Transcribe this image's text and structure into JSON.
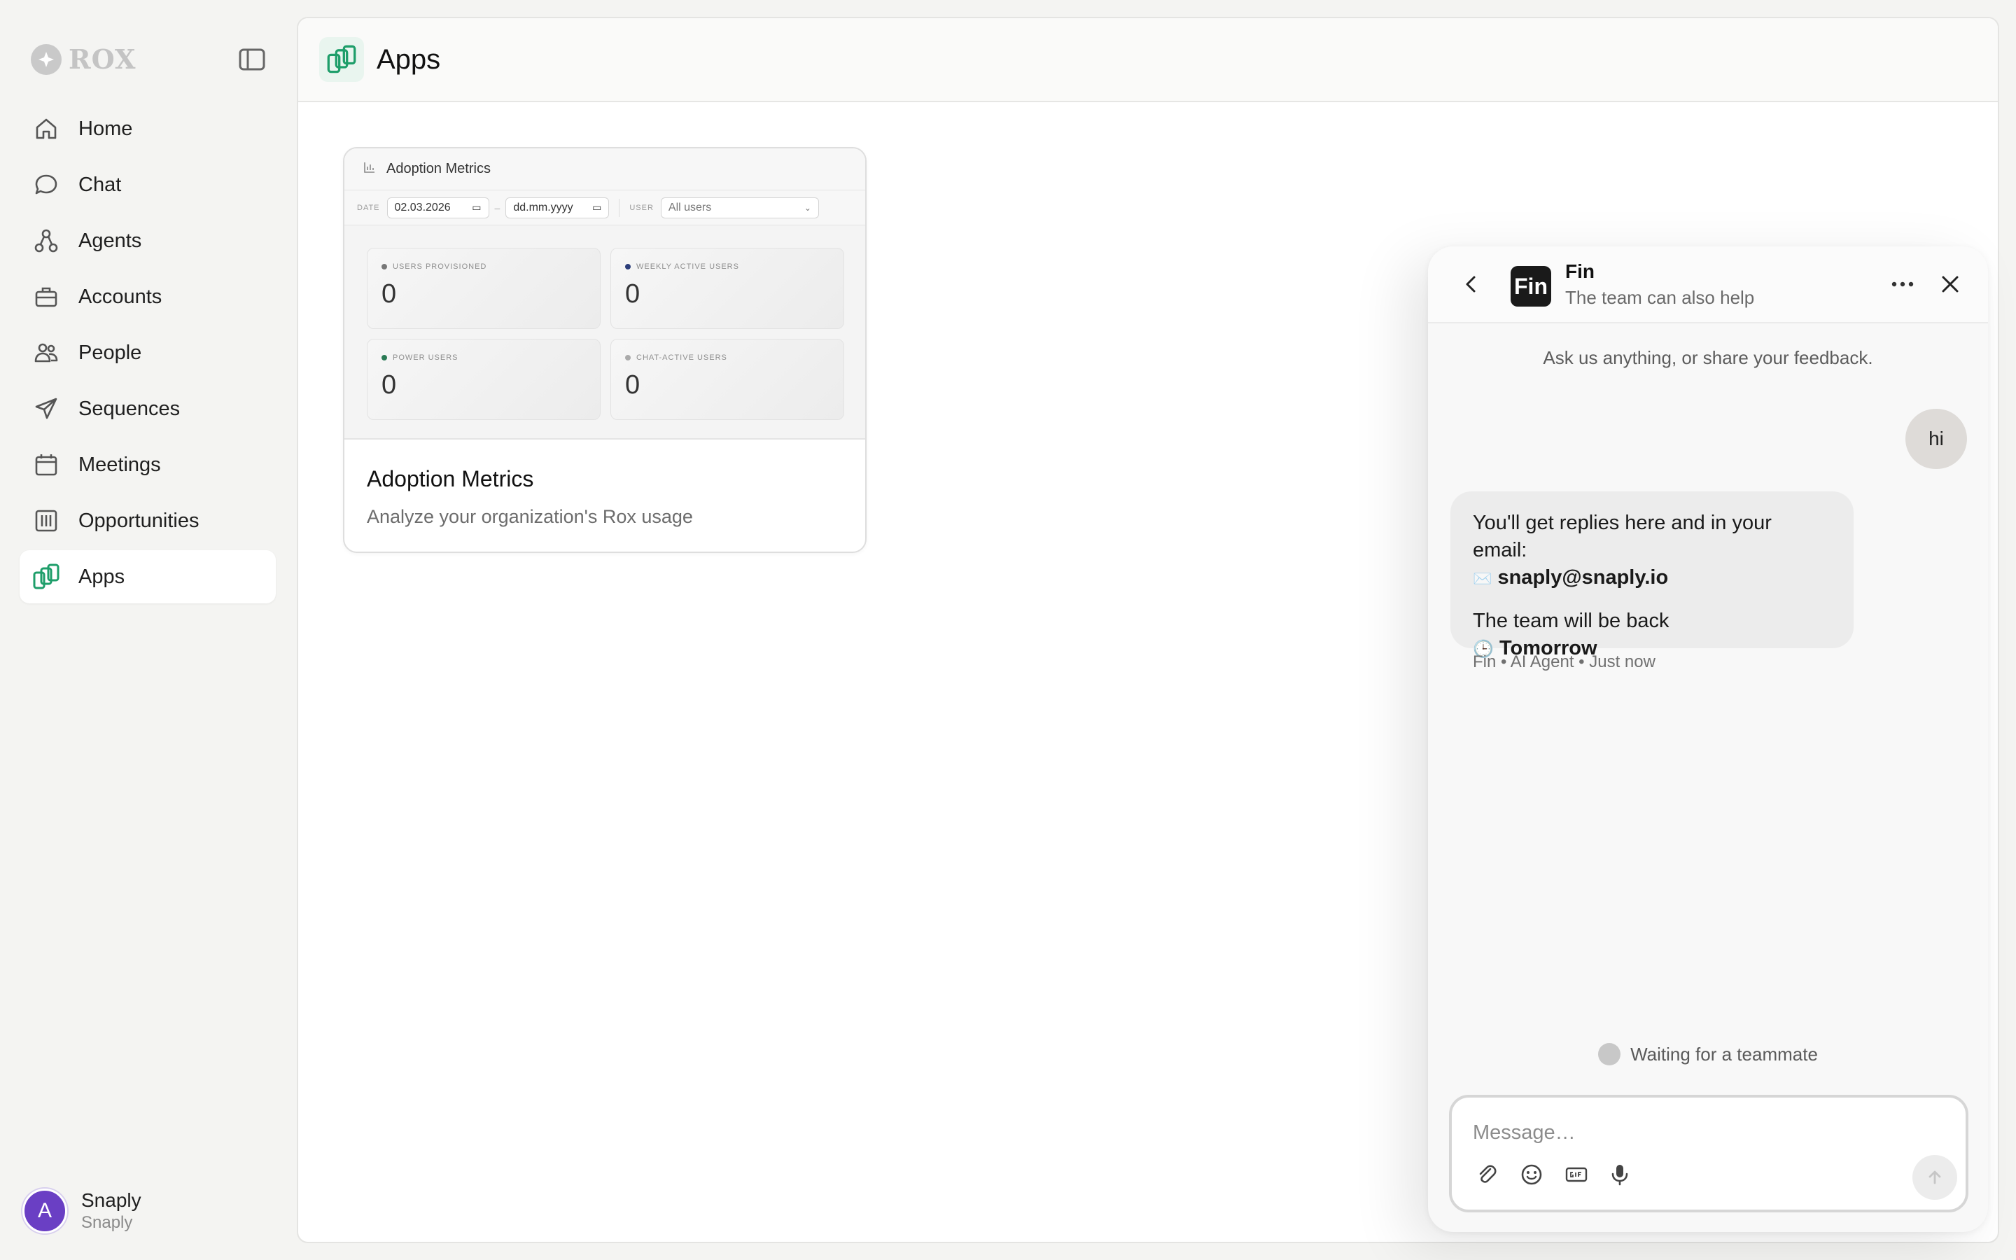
{
  "brand": {
    "name": "ROX"
  },
  "sidebar": {
    "items": [
      {
        "label": "Home",
        "icon": "home-icon"
      },
      {
        "label": "Chat",
        "icon": "chat-bubble-icon"
      },
      {
        "label": "Agents",
        "icon": "agents-icon"
      },
      {
        "label": "Accounts",
        "icon": "briefcase-icon"
      },
      {
        "label": "People",
        "icon": "people-icon"
      },
      {
        "label": "Sequences",
        "icon": "paper-plane-icon"
      },
      {
        "label": "Meetings",
        "icon": "calendar-icon"
      },
      {
        "label": "Opportunities",
        "icon": "columns-icon"
      },
      {
        "label": "Apps",
        "icon": "apps-icon",
        "active": true
      }
    ]
  },
  "user": {
    "avatar_letter": "A",
    "name": "Snaply",
    "org": "Snaply"
  },
  "main": {
    "title": "Apps",
    "card": {
      "title": "Adoption Metrics",
      "description": "Analyze your organization's Rox usage",
      "preview": {
        "title": "Adoption Metrics",
        "date_label": "DATE",
        "date_from": "02.03.2026",
        "date_sep": "–",
        "date_to": "dd.mm.yyyy",
        "user_label": "USER",
        "user_value": "All users",
        "tiles": [
          {
            "label": "USERS PROVISIONED",
            "value": "0"
          },
          {
            "label": "WEEKLY ACTIVE USERS",
            "value": "0"
          },
          {
            "label": "POWER USERS",
            "value": "0"
          },
          {
            "label": "CHAT-ACTIVE USERS",
            "value": "0"
          }
        ]
      }
    }
  },
  "chat": {
    "logo": "Fin",
    "title": "Fin",
    "subtitle": "The team can also help",
    "intro": "Ask us anything, or share your feedback.",
    "user_message": "hi",
    "bot": {
      "line1": "You'll get replies here and in your email:",
      "email_icon": "✉️",
      "email": "snaply@snaply.io",
      "line2": "The team will be back",
      "clock_icon": "🕒",
      "when": "Tomorrow"
    },
    "meta": "Fin • AI Agent • Just now",
    "waiting": "Waiting for a teammate",
    "input_placeholder": "Message…",
    "input_value": ""
  }
}
